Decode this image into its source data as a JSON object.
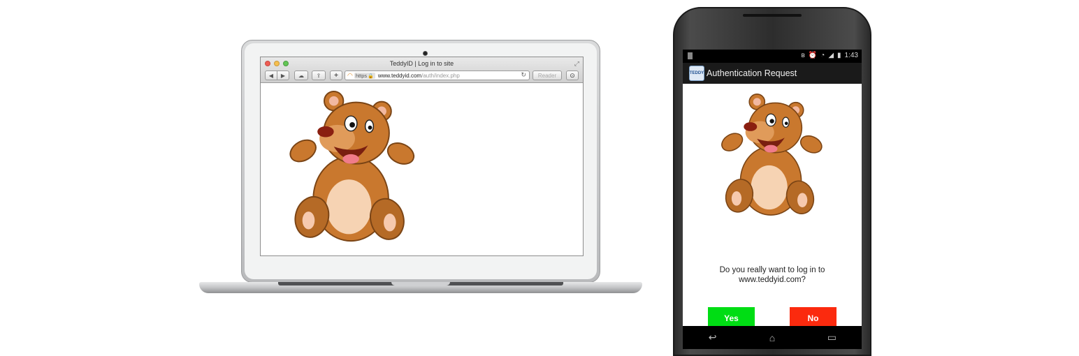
{
  "browser": {
    "window_title": "TeddyID | Log in to site",
    "back_icon": "◀",
    "forward_icon": "▶",
    "icloud_icon": "☁",
    "share_icon": "⇪",
    "add_icon": "+",
    "https_label": "https",
    "lock_icon": "🔒",
    "url_host": "www.teddyid.com",
    "url_path": "/auth/index.php",
    "reload_icon": "↻",
    "reader_label": "Reader",
    "download_icon": "⊙",
    "fullscreen_icon": "⤢"
  },
  "phone": {
    "time": "1:43",
    "app_icon_text": "TEDDY",
    "app_title": "Authentication Request",
    "prompt_line1": "Do you really want to log in to",
    "prompt_line2": "www.teddyid.com?",
    "yes_label": "Yes",
    "no_label": "No",
    "back_key": "↩",
    "home_key": "⌂",
    "recents_key": "▭"
  },
  "colors": {
    "yes_button": "#00dd14",
    "no_button": "#fb2a0e",
    "bear_fur": "#c9782e",
    "bear_belly": "#f6d3b3"
  }
}
